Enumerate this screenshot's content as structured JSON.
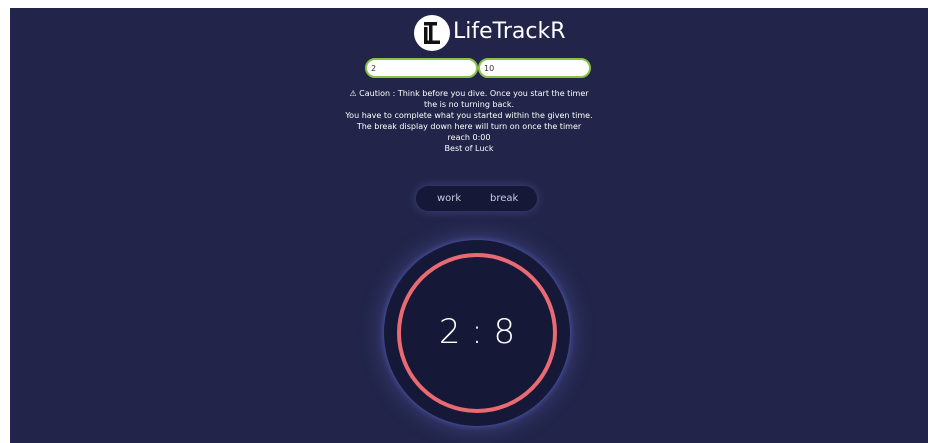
{
  "header": {
    "logo_icon": "lt-monogram-logo",
    "app_name": "LifeTrackR"
  },
  "inputs": {
    "work_value": "2",
    "break_value": "10"
  },
  "notice": {
    "lines": [
      "⚠ Caution : Think before you dive. Once you start the timer",
      "the is no turning back.",
      "You have to complete what you started within the given time.",
      "The break display down here will turn on once the timer",
      "reach 0:00",
      "Best of Luck"
    ]
  },
  "toggle": {
    "work_label": "work",
    "break_label": "break"
  },
  "timer": {
    "display": "2 : 8",
    "ring_color": "#e86a72"
  },
  "colors": {
    "background": "#222549",
    "panel": "#151836",
    "input_border": "#8bc34a"
  }
}
